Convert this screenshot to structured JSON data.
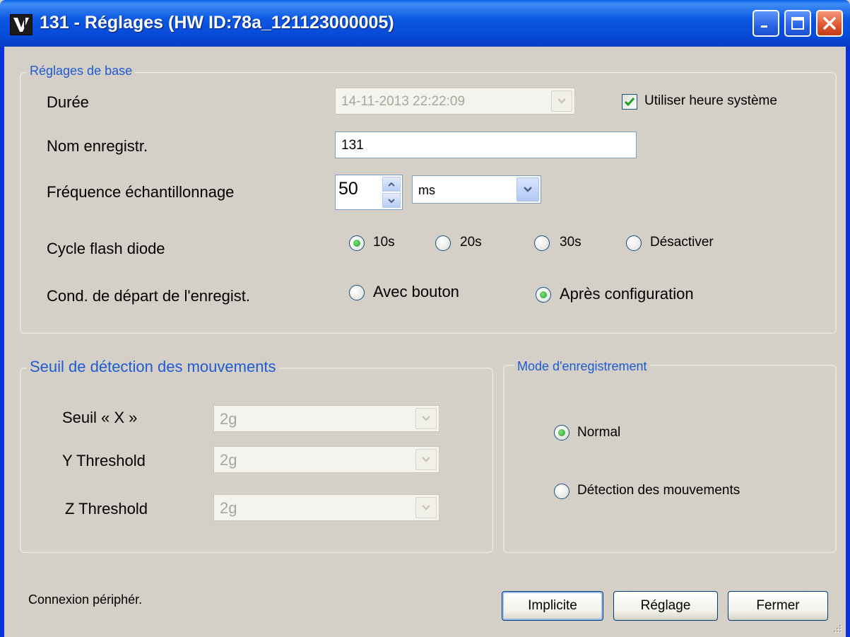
{
  "window": {
    "title": "131 - Réglages (HW ID:78a_121123000005)"
  },
  "basic": {
    "legend": "Réglages de base",
    "duration_label": "Durée",
    "duration_value": "14-11-2013 22:22:09",
    "use_system_time_label": "Utiliser heure système",
    "use_system_time_checked": true,
    "name_label": "Nom enregistr.",
    "name_value": "131",
    "freq_label": "Fréquence échantillonnage",
    "freq_value": "50",
    "freq_unit": "ms",
    "flash_label": "Cycle flash diode",
    "flash_options": [
      "10s",
      "20s",
      "30s",
      "Désactiver"
    ],
    "flash_selected": "10s",
    "start_label": "Cond. de départ de l'enregist.",
    "start_options": [
      "Avec bouton",
      "Après configuration"
    ],
    "start_selected": "Après configuration"
  },
  "motion": {
    "legend": "Seuil de détection des mouvements",
    "x_label": "Seuil « X »",
    "x_value": "2g",
    "y_label": "Y Threshold",
    "y_value": "2g",
    "z_label": "Z Threshold",
    "z_value": "2g"
  },
  "mode": {
    "legend": "Mode d'enregistrement",
    "options": [
      "Normal",
      "Détection des mouvements"
    ],
    "selected": "Normal"
  },
  "footer": {
    "status": "Connexion périphér.",
    "default_button": "Implicite",
    "apply_button": "Réglage",
    "close_button": "Fermer"
  },
  "colors": {
    "titlebar": "#0a5fe8",
    "group_legend": "#1f5bd1",
    "window_bg": "#d4d0c8"
  }
}
